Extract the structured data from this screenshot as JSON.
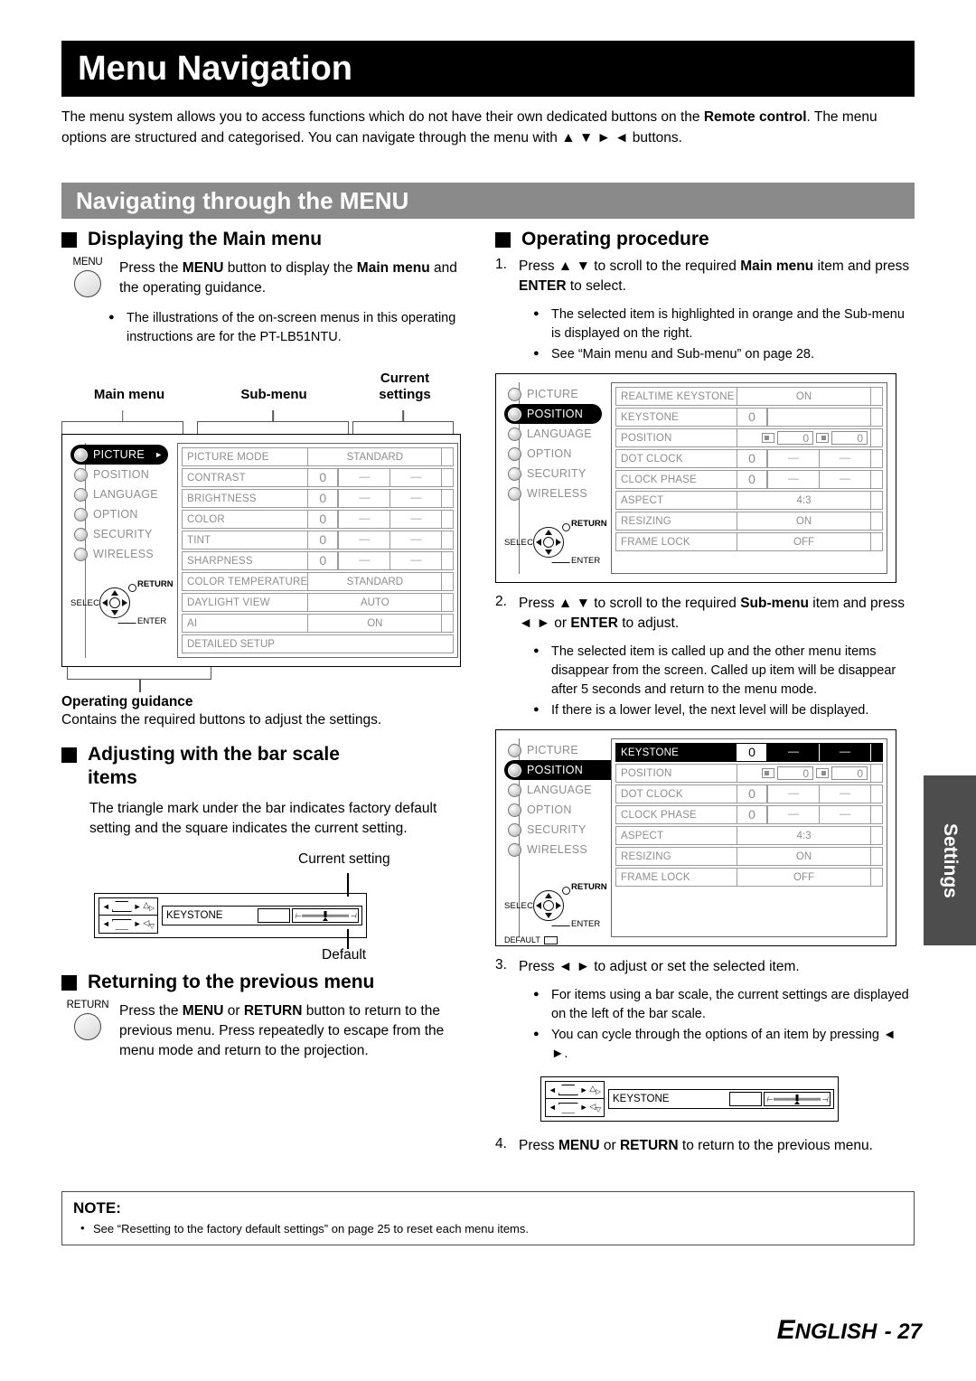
{
  "page": {
    "title": "Menu Navigation",
    "section_title": "Navigating through the MENU",
    "intro_part1": "The menu system allows you to access functions which do not have their own dedicated buttons on the ",
    "intro_bold1": "Remote control",
    "intro_part2": ". The menu options are structured and categorised. You can navigate through the menu with ▲ ▼ ► ◄ buttons.",
    "footer_lang": "E",
    "footer_rest": "NGLISH",
    "footer_page": "- 27",
    "side_tab": "Settings"
  },
  "left": {
    "displaying": {
      "heading": "Displaying the Main menu",
      "button_label": "MENU",
      "body_pre": "Press the ",
      "body_b1": "MENU",
      "body_mid": " button to display the ",
      "body_b2": "Main menu",
      "body_post": " and the operating guidance.",
      "bullets": [
        "The illustrations of the on-screen menus in this operating instructions are for the PT-LB51NTU."
      ]
    },
    "captions": {
      "main_menu": "Main menu",
      "sub_menu": "Sub-menu",
      "current_settings_l1": "Current",
      "current_settings_l2": "settings"
    },
    "guidance": {
      "title": "Operating guidance",
      "text": "Contains the required buttons to adjust the settings."
    },
    "barscale": {
      "heading_l1": "Adjusting with the bar scale",
      "heading_l2": "items",
      "body": "The triangle mark under the bar indicates factory default setting and the square indicates the current setting.",
      "callout_current": "Current setting",
      "callout_default": "Default",
      "item_name": "KEYSTONE"
    },
    "returning": {
      "heading": "Returning to the previous menu",
      "button_label": "RETURN",
      "body_pre": "Press the ",
      "body_b1": "MENU",
      "body_mid": " or ",
      "body_b2": "RETURN",
      "body_post": " button to return to the previous menu. Press repeatedly to escape from the menu mode and return to the projection."
    }
  },
  "right": {
    "heading": "Operating procedure",
    "steps": [
      {
        "num": "1.",
        "text_pre": "Press ▲ ▼ to scroll to the required ",
        "text_b1": "Main menu",
        "text_post": " item and press ",
        "text_b2": "ENTER",
        "text_end": " to select.",
        "bullets": [
          "The selected item is highlighted in orange and the Sub-menu is displayed on the right.",
          "See “Main menu and Sub-menu” on page 28."
        ]
      },
      {
        "num": "2.",
        "text_pre": "Press ▲ ▼ to scroll to the required ",
        "text_b1": "Sub-menu",
        "text_post": " item and press ◄ ► or ",
        "text_b2": "ENTER",
        "text_end": " to adjust.",
        "bullets": [
          "The selected item is called up and the other menu items disappear from the screen. Called up item will be disappear after 5 seconds and return to the menu mode.",
          "If there is a lower level, the next level will be displayed."
        ]
      },
      {
        "num": "3.",
        "text_pre": "Press ◄ ► to adjust or set the selected item.",
        "text_b1": "",
        "text_post": "",
        "text_b2": "",
        "text_end": "",
        "bullets": [
          "For items using a bar scale, the current settings are displayed on the left of the bar scale.",
          "You can cycle through the options of an item by pressing ◄ ►."
        ]
      },
      {
        "num": "4.",
        "text_pre": "Press ",
        "text_b1": "MENU",
        "text_post": " or ",
        "text_b2": "RETURN",
        "text_end": " to return to the previous menu.",
        "bullets": []
      }
    ],
    "barfig_item_name": "KEYSTONE"
  },
  "osd_common": {
    "main_items": [
      "PICTURE",
      "POSITION",
      "LANGUAGE",
      "OPTION",
      "SECURITY",
      "WIRELESS"
    ],
    "guide_select": "SELECT",
    "guide_return": "RETURN",
    "guide_enter": "ENTER",
    "guide_default": "DEFAULT"
  },
  "osd_picture": {
    "selected_main": "PICTURE",
    "rows": [
      {
        "name": "PICTURE MODE",
        "type": "text",
        "value": "STANDARD"
      },
      {
        "name": "CONTRAST",
        "type": "numbar",
        "value": "0",
        "seg1": "––",
        "seg2": "––"
      },
      {
        "name": "BRIGHTNESS",
        "type": "numbar",
        "value": "0",
        "seg1": "––",
        "seg2": "––"
      },
      {
        "name": "COLOR",
        "type": "numbar",
        "value": "0",
        "seg1": "––",
        "seg2": "––"
      },
      {
        "name": "TINT",
        "type": "numbar",
        "value": "0",
        "seg1": "––",
        "seg2": "––"
      },
      {
        "name": "SHARPNESS",
        "type": "numbar",
        "value": "0",
        "seg1": "––",
        "seg2": "––"
      },
      {
        "name": "COLOR TEMPERATURE",
        "type": "text",
        "value": "STANDARD"
      },
      {
        "name": "DAYLIGHT VIEW",
        "type": "text",
        "value": "AUTO"
      },
      {
        "name": "AI",
        "type": "text",
        "value": "ON"
      },
      {
        "name": "DETAILED SETUP",
        "type": "full",
        "value": ""
      }
    ]
  },
  "osd_position": {
    "selected_main": "POSITION",
    "rows": [
      {
        "name": "REALTIME KEYSTONE",
        "type": "text",
        "value": "ON"
      },
      {
        "name": "KEYSTONE",
        "type": "numbar",
        "value": "0",
        "seg1": "",
        "seg2": ""
      },
      {
        "name": "POSITION",
        "type": "pos",
        "value": "0",
        "value2": "0"
      },
      {
        "name": "DOT CLOCK",
        "type": "numbar",
        "value": "0",
        "seg1": "––",
        "seg2": "––"
      },
      {
        "name": "CLOCK PHASE",
        "type": "numbar",
        "value": "0",
        "seg1": "––",
        "seg2": "––"
      },
      {
        "name": "ASPECT",
        "type": "text",
        "value": "4:3"
      },
      {
        "name": "RESIZING",
        "type": "text",
        "value": "ON"
      },
      {
        "name": "FRAME LOCK",
        "type": "text",
        "value": "OFF"
      }
    ]
  },
  "osd_keystone": {
    "selected_main": "POSITION",
    "rows": [
      {
        "name": "KEYSTONE",
        "type": "numbar",
        "value": "0",
        "seg1": "––",
        "seg2": "––",
        "highlight": true
      },
      {
        "name": "POSITION",
        "type": "pos",
        "value": "0",
        "value2": "0"
      },
      {
        "name": "DOT CLOCK",
        "type": "numbar",
        "value": "0",
        "seg1": "––",
        "seg2": "––"
      },
      {
        "name": "CLOCK PHASE",
        "type": "numbar",
        "value": "0",
        "seg1": "––",
        "seg2": "––"
      },
      {
        "name": "ASPECT",
        "type": "text",
        "value": "4:3"
      },
      {
        "name": "RESIZING",
        "type": "text",
        "value": "ON"
      },
      {
        "name": "FRAME LOCK",
        "type": "text",
        "value": "OFF"
      }
    ]
  },
  "note": {
    "title": "NOTE:",
    "items": [
      "See “Resetting to the factory default settings” on page 25 to reset each menu items."
    ]
  }
}
